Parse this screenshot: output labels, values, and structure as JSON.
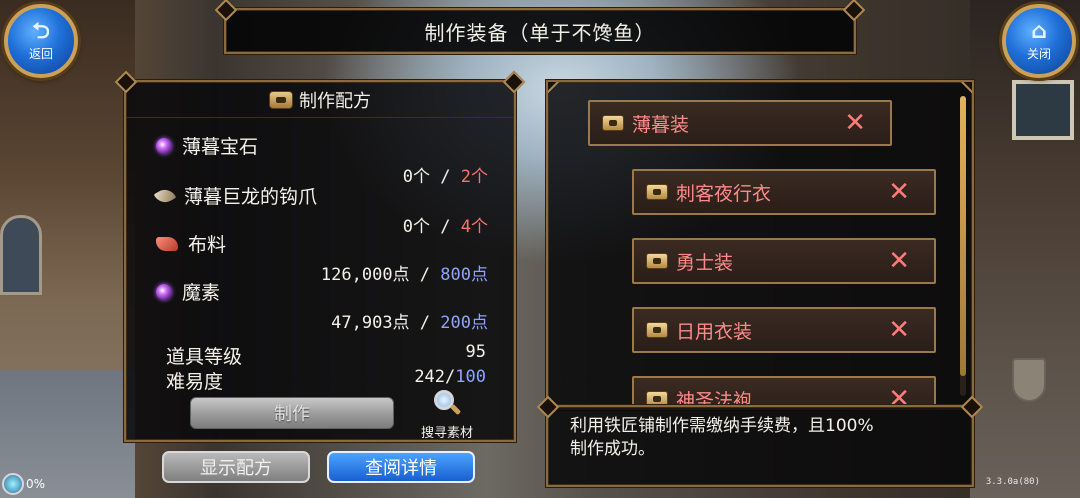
{
  "header": {
    "back_label": "返回",
    "close_label": "关闭",
    "title": "制作装备（单于不馋鱼）"
  },
  "recipe": {
    "header_label": "制作配方",
    "materials": [
      {
        "name": "薄暮宝石",
        "icon": "gem-icon",
        "have": "0个",
        "sep": " / ",
        "need": "2个",
        "need_color": "#ff7070"
      },
      {
        "name": "薄暮巨龙的钩爪",
        "icon": "claw-icon",
        "have": "0个",
        "sep": " / ",
        "need": "4个",
        "need_color": "#ff7070"
      },
      {
        "name": "布料",
        "icon": "cloth-icon",
        "have": "126,000点",
        "sep": " / ",
        "need": "800点",
        "need_color": "#8fa4ff"
      },
      {
        "name": "魔素",
        "icon": "gem-icon",
        "have": "47,903点",
        "sep": " / ",
        "need": "200点",
        "need_color": "#8fa4ff"
      }
    ],
    "item_level_label": "道具等级",
    "item_level_value": "95",
    "difficulty_label": "难易度",
    "difficulty_current": "242",
    "difficulty_sep": "/",
    "difficulty_max": "100",
    "craft_label": "制作",
    "search_label": "搜寻素材"
  },
  "buttons": {
    "show_recipe": "显示配方",
    "view_details": "查阅详情"
  },
  "list": {
    "items": [
      {
        "label": "薄暮装"
      },
      {
        "label": "刺客夜行衣"
      },
      {
        "label": "勇士装"
      },
      {
        "label": "日用衣装"
      },
      {
        "label": "神圣法袍"
      }
    ],
    "remove_symbol": "✕"
  },
  "info": {
    "text_line1": "利用铁匠铺制作需缴纳手续费，且100%",
    "text_line2": "制作成功。"
  },
  "status": {
    "percent": "0%",
    "version": "3.3.0a(80)"
  },
  "colors": {
    "accent_gold": "#c9a15a",
    "list_text": "#ff8a8a",
    "need_red": "#ff7070",
    "need_blue": "#8fa4ff"
  }
}
